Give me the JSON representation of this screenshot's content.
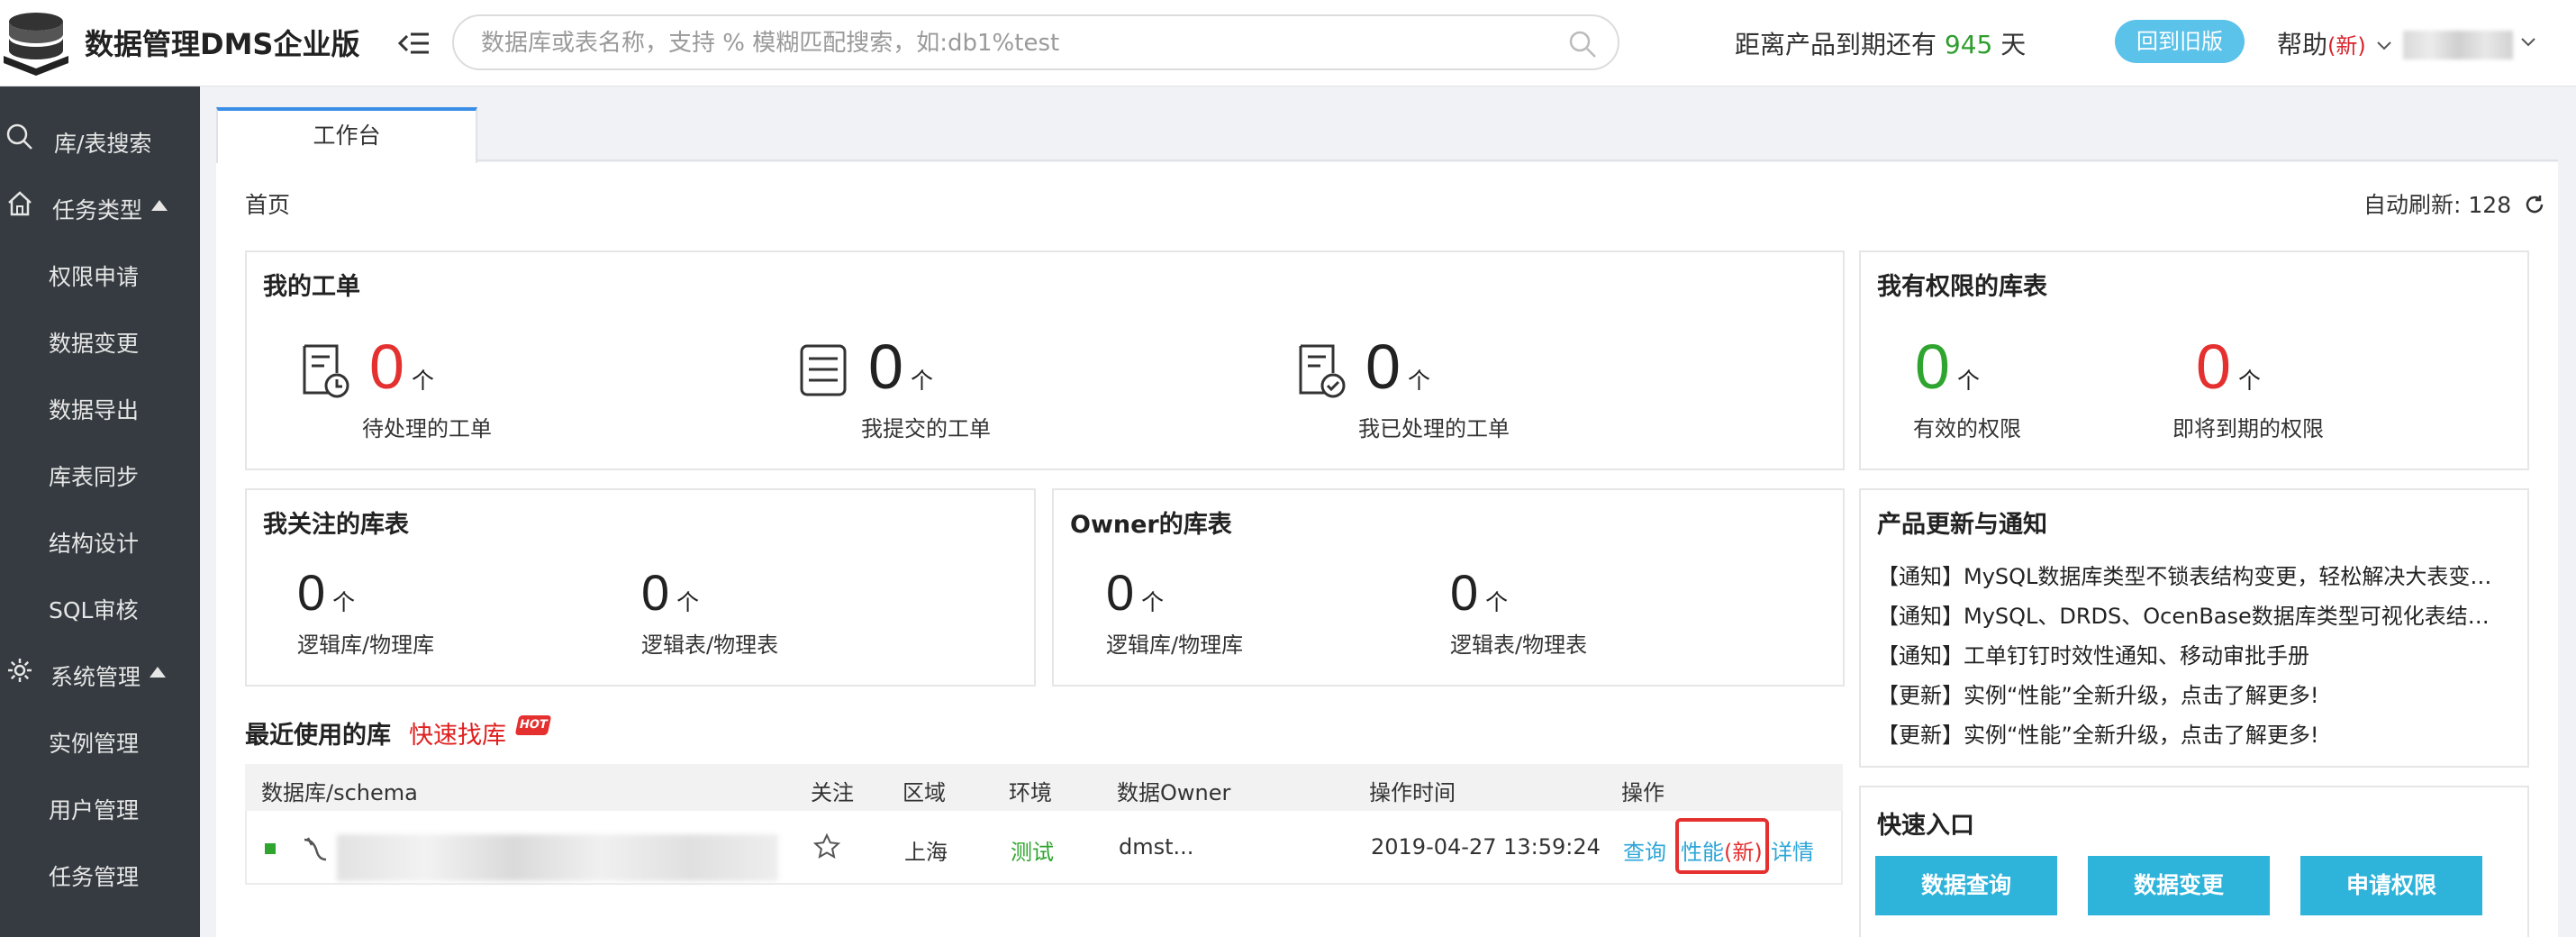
{
  "header": {
    "app_title": "数据管理DMS企业版",
    "search_placeholder": "数据库或表名称，支持 % 模糊匹配搜索，如:db1%test",
    "expire_prefix": "距离产品到期还有",
    "expire_days": "945",
    "expire_suffix": "天",
    "old_version_button": "回到旧版",
    "help_label": "帮助",
    "help_new": "(新)"
  },
  "sidebar": {
    "search": "库/表搜索",
    "task_types": "任务类型",
    "task_items": [
      "权限申请",
      "数据变更",
      "数据导出",
      "库表同步",
      "结构设计",
      "SQL审核"
    ],
    "system_mgmt": "系统管理",
    "system_items": [
      "实例管理",
      "用户管理",
      "任务管理"
    ]
  },
  "tabs": {
    "workbench": "工作台"
  },
  "breadcrumb": "首页",
  "auto_refresh": {
    "label": "自动刷新:",
    "value": "128"
  },
  "my_orders": {
    "title": "我的工单",
    "items": [
      {
        "count": "0",
        "unit": "个",
        "label": "待处理的工单"
      },
      {
        "count": "0",
        "unit": "个",
        "label": "我提交的工单"
      },
      {
        "count": "0",
        "unit": "个",
        "label": "我已处理的工单"
      }
    ]
  },
  "my_permissions": {
    "title": "我有权限的库表",
    "items": [
      {
        "count": "0",
        "unit": "个",
        "label": "有效的权限"
      },
      {
        "count": "0",
        "unit": "个",
        "label": "即将到期的权限"
      }
    ]
  },
  "followed_tables": {
    "title": "我关注的库表",
    "items": [
      {
        "count": "0",
        "unit": "个",
        "label": "逻辑库/物理库"
      },
      {
        "count": "0",
        "unit": "个",
        "label": "逻辑表/物理表"
      }
    ]
  },
  "owner_tables": {
    "title": "Owner的库表",
    "items": [
      {
        "count": "0",
        "unit": "个",
        "label": "逻辑库/物理库"
      },
      {
        "count": "0",
        "unit": "个",
        "label": "逻辑表/物理表"
      }
    ]
  },
  "notices": {
    "title": "产品更新与通知",
    "items": [
      "【通知】MySQL数据库类型不锁表结构变更，轻松解决大表变更...",
      "【通知】MySQL、DRDS、OcenBase数据库类型可视化表结构...",
      "【通知】工单钉钉时效性通知、移动审批手册",
      "【更新】实例“性能”全新升级，点击了解更多!",
      "【更新】实例“性能”全新升级，点击了解更多!"
    ]
  },
  "quick_entry": {
    "title": "快速入口",
    "buttons": [
      "数据查询",
      "数据变更",
      "申请权限"
    ]
  },
  "recent": {
    "title": "最近使用的库",
    "quick_find": "快速找库",
    "hot": "HOT",
    "columns": [
      "数据库/schema",
      "关注",
      "区域",
      "环境",
      "数据Owner",
      "操作时间",
      "操作"
    ],
    "row": {
      "region": "上海",
      "env": "测试",
      "owner": "dmst...",
      "time": "2019-04-27 13:59:24",
      "action_query": "查询",
      "action_perf": "性能",
      "action_perf_new": "(新)",
      "action_detail": "详情"
    }
  },
  "colors": {
    "sidebar_bg": "#353b40",
    "accent_blue": "#2eb3da",
    "link_blue": "#2ea6d8",
    "red": "#e53030",
    "green": "#2fa52f"
  }
}
